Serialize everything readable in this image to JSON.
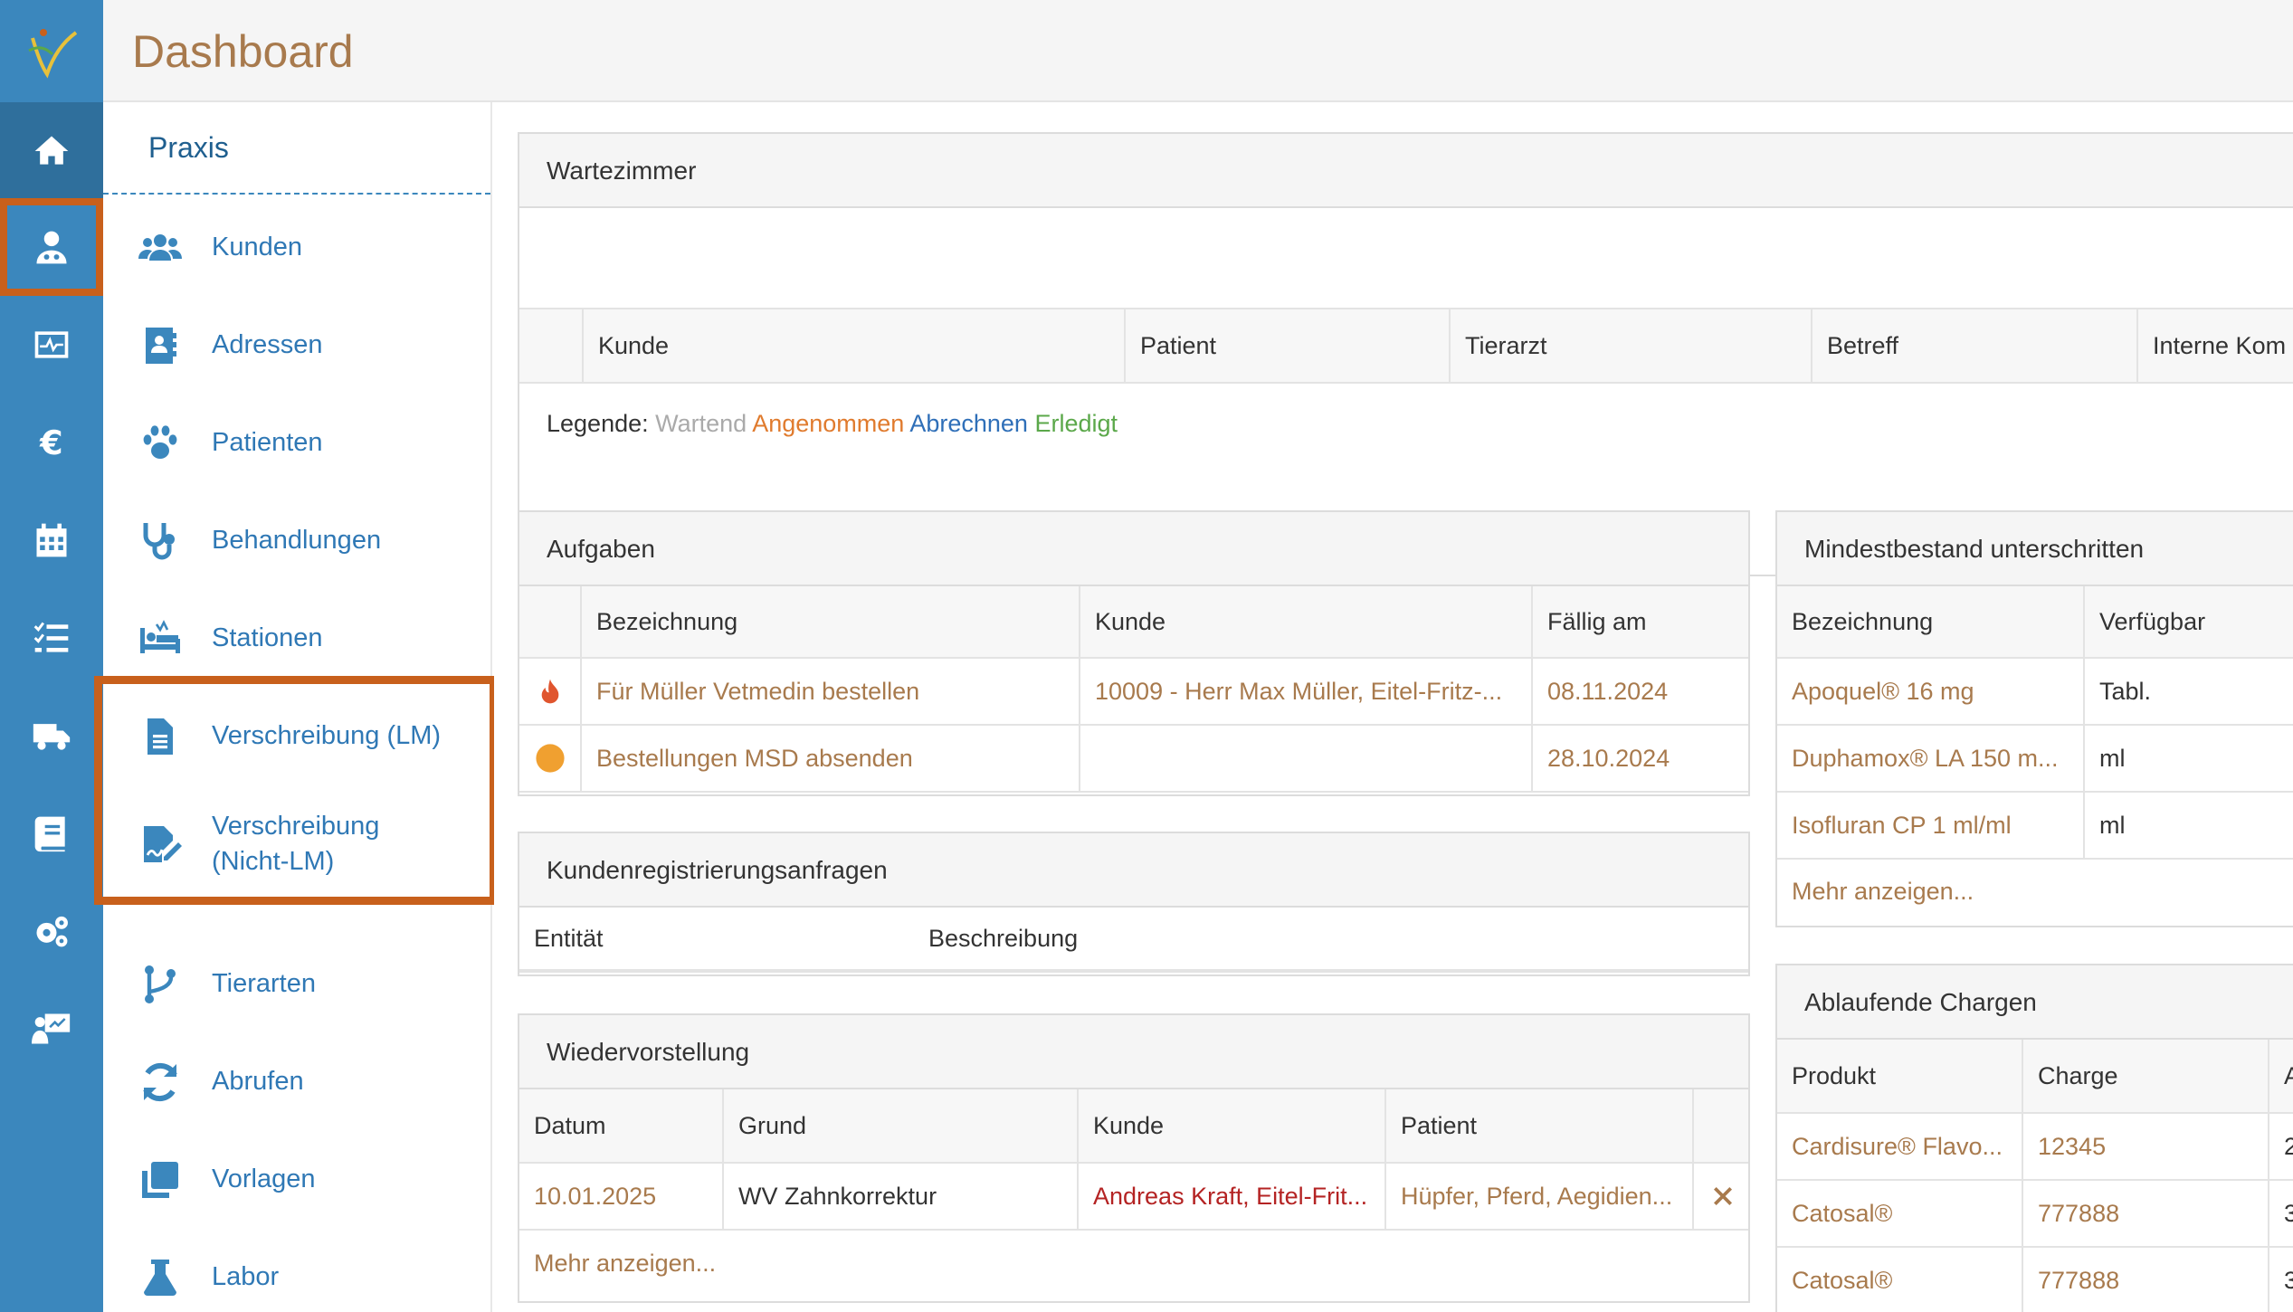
{
  "header": {
    "title": "Dashboard"
  },
  "iconbar": {
    "items": [
      {
        "icon": "home-icon"
      },
      {
        "icon": "doctor-icon"
      },
      {
        "icon": "monitor-icon"
      },
      {
        "icon": "euro-icon"
      },
      {
        "icon": "calendar-icon"
      },
      {
        "icon": "tasklist-icon"
      },
      {
        "icon": "truck-icon"
      },
      {
        "icon": "book-icon"
      },
      {
        "icon": "settings-icon"
      },
      {
        "icon": "presentation-icon"
      }
    ]
  },
  "submenu": {
    "title": "Praxis",
    "items": [
      {
        "label": "Kunden",
        "icon": "users-icon"
      },
      {
        "label": "Adressen",
        "icon": "address-book-icon"
      },
      {
        "label": "Patienten",
        "icon": "paw-icon"
      },
      {
        "label": "Behandlungen",
        "icon": "stethoscope-icon"
      },
      {
        "label": "Stationen",
        "icon": "bed-icon"
      },
      {
        "label": "Verschreibung (LM)",
        "icon": "document-icon"
      },
      {
        "label": "Verschreibung (Nicht-LM)",
        "icon": "signature-icon"
      },
      {
        "label": "Tierarten",
        "icon": "branch-icon"
      },
      {
        "label": "Abrufen",
        "icon": "refresh-icon"
      },
      {
        "label": "Vorlagen",
        "icon": "copy-icon"
      },
      {
        "label": "Labor",
        "icon": "flask-icon"
      }
    ]
  },
  "wartezimmer": {
    "title": "Wartezimmer",
    "columns": [
      "Kunde",
      "Patient",
      "Tierarzt",
      "Betreff",
      "Interne Kom"
    ],
    "legend_label": "Legende:",
    "legend": [
      {
        "label": "Wartend",
        "color": "#aaaaaa"
      },
      {
        "label": "Angenommen",
        "color": "#e07b2e"
      },
      {
        "label": "Abrechnen",
        "color": "#2f6fb8"
      },
      {
        "label": "Erledigt",
        "color": "#5ba84a"
      }
    ]
  },
  "aufgaben": {
    "title": "Aufgaben",
    "columns": [
      "Bezeichnung",
      "Kunde",
      "Fällig am"
    ],
    "rows": [
      {
        "icon": "flame-icon",
        "bezeichnung": "Für Müller Vetmedin bestellen",
        "kunde": "10009 - Herr Max Müller, Eitel-Fritz-...",
        "faellig": "08.11.2024"
      },
      {
        "icon": "orange-dot-icon",
        "bezeichnung": "Bestellungen MSD absenden",
        "kunde": "",
        "faellig": "28.10.2024"
      }
    ]
  },
  "kundenregistrierung": {
    "title": "Kundenregistrierungsanfragen",
    "columns": [
      "Entität",
      "Beschreibung"
    ]
  },
  "wiedervorstellung": {
    "title": "Wiedervorstellung",
    "columns": [
      "Datum",
      "Grund",
      "Kunde",
      "Patient"
    ],
    "rows": [
      {
        "datum": "10.01.2025",
        "grund": "WV Zahnkorrektur",
        "kunde": "Andreas Kraft, Eitel-Frit...",
        "patient": "Hüpfer, Pferd, Aegidien..."
      }
    ],
    "more": "Mehr anzeigen..."
  },
  "mindestbestand": {
    "title": "Mindestbestand unterschritten",
    "columns": [
      "Bezeichnung",
      "Verfügbar"
    ],
    "rows": [
      {
        "bezeichnung": "Apoquel® 16 mg",
        "verfuegbar": "Tabl."
      },
      {
        "bezeichnung": "Duphamox® LA 150 m...",
        "verfuegbar": "ml"
      },
      {
        "bezeichnung": "Isofluran CP 1 ml/ml",
        "verfuegbar": "ml"
      }
    ],
    "more": "Mehr anzeigen..."
  },
  "chargen": {
    "title": "Ablaufende Chargen",
    "columns": [
      "Produkt",
      "Charge",
      "A"
    ],
    "rows": [
      {
        "produkt": "Cardisure® Flavo...",
        "charge": "12345",
        "extra": "2"
      },
      {
        "produkt": "Catosal®",
        "charge": "777888",
        "extra": "3"
      },
      {
        "produkt": "Catosal®",
        "charge": "777888",
        "extra": "3"
      }
    ]
  },
  "colors": {
    "sidebar": "#3b87bd",
    "highlight": "#c8601c",
    "link_brown": "#a87a4d",
    "link_red": "#b42323"
  }
}
